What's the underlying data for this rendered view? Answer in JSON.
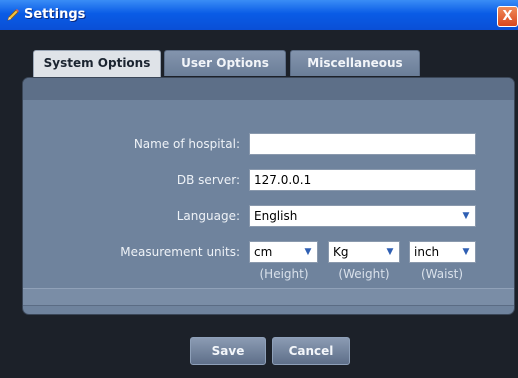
{
  "window": {
    "title": "Settings",
    "close_label": "X"
  },
  "tabs": [
    {
      "label": "System Options",
      "active": true
    },
    {
      "label": "User Options",
      "active": false
    },
    {
      "label": "Miscellaneous",
      "active": false
    }
  ],
  "form": {
    "hospital": {
      "label": "Name of hospital:",
      "value": ""
    },
    "db_server": {
      "label": "DB server:",
      "value": "127.0.0.1"
    },
    "language": {
      "label": "Language:",
      "value": "English"
    },
    "units": {
      "label": "Measurement units:",
      "height": {
        "value": "cm",
        "caption": "(Height)"
      },
      "weight": {
        "value": "Kg",
        "caption": "(Weight)"
      },
      "waist": {
        "value": "inch",
        "caption": "(Waist)"
      }
    }
  },
  "buttons": {
    "save": "Save",
    "cancel": "Cancel"
  },
  "icons": {
    "title": "settings-pencil-icon",
    "dropdown": "chevron-down-icon"
  },
  "colors": {
    "titlebar": "#0a5ce6",
    "panel": "#6f839d",
    "background": "#1c2129"
  }
}
